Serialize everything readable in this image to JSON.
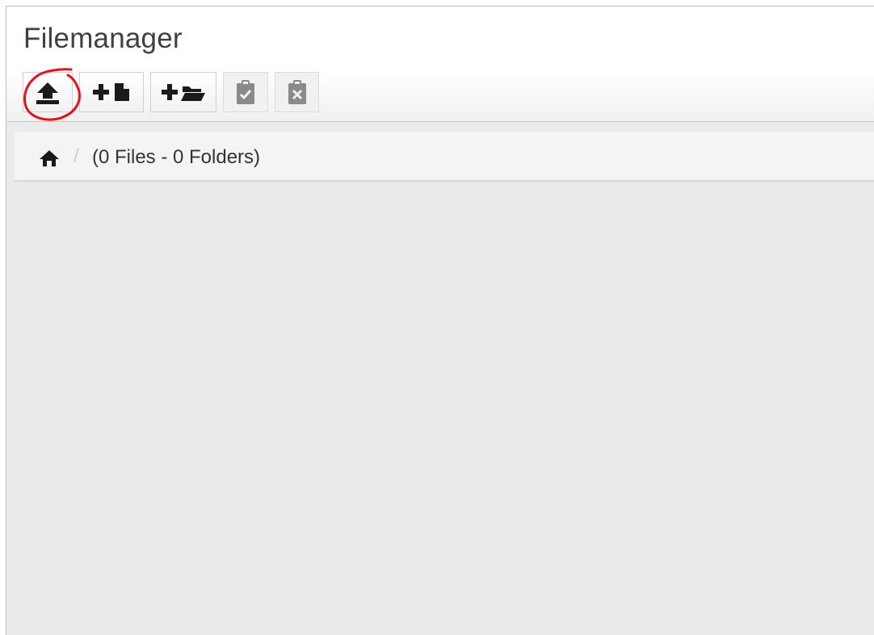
{
  "app": {
    "title": "Filemanager"
  },
  "toolbar": {
    "buttons": [
      {
        "name": "upload",
        "icon": "upload-icon",
        "enabled": true,
        "highlighted": true
      },
      {
        "name": "new-file",
        "icon": "add-file-icon",
        "enabled": true
      },
      {
        "name": "new-folder",
        "icon": "add-folder-icon",
        "enabled": true
      },
      {
        "name": "paste",
        "icon": "clipboard-check-icon",
        "enabled": false
      },
      {
        "name": "clear-clipboard",
        "icon": "clipboard-x-icon",
        "enabled": false
      }
    ]
  },
  "breadcrumb": {
    "home_icon": "home-icon",
    "separator": "/",
    "summary": "(0 Files - 0 Folders)"
  },
  "colors": {
    "annotation": "#e0141e",
    "icon": "#1a1a1a",
    "icon_disabled": "#8a8a8a",
    "content_bg": "#ebebeb"
  }
}
